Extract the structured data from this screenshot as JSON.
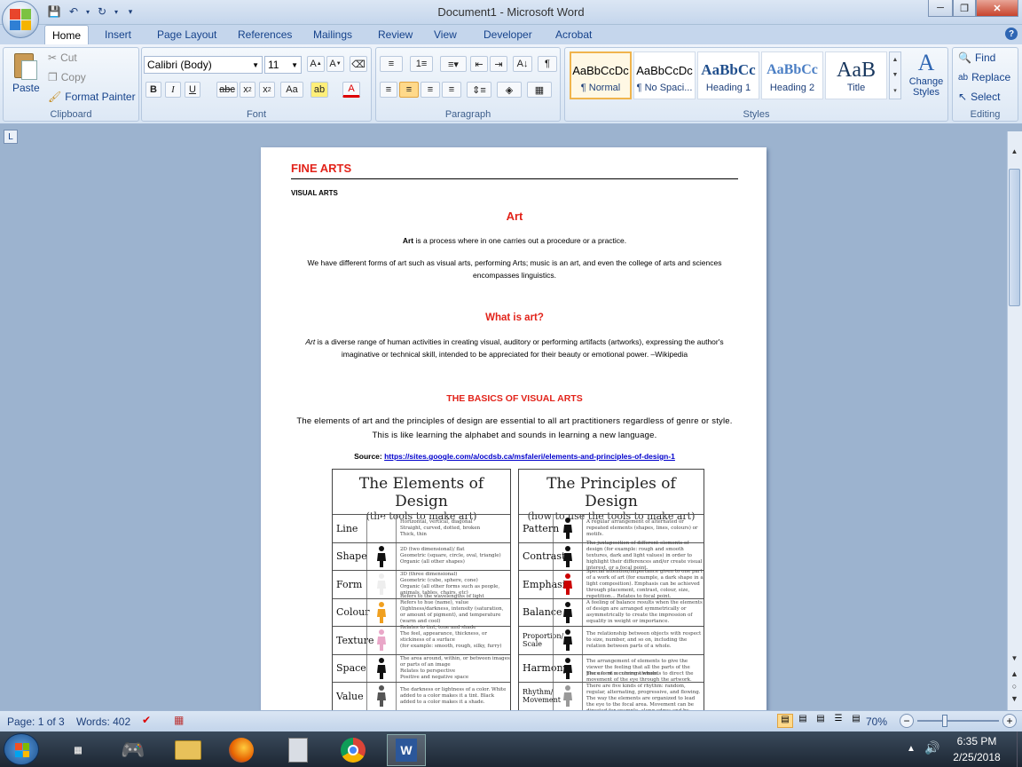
{
  "window": {
    "title": "Document1 - Microsoft Word"
  },
  "tabs": [
    "Home",
    "Insert",
    "Page Layout",
    "References",
    "Mailings",
    "Review",
    "View",
    "Developer",
    "Acrobat"
  ],
  "clipboard": {
    "paste": "Paste",
    "cut": "Cut",
    "copy": "Copy",
    "format_painter": "Format Painter",
    "label": "Clipboard"
  },
  "font": {
    "name": "Calibri (Body)",
    "size": "11",
    "label": "Font"
  },
  "paragraph": {
    "label": "Paragraph"
  },
  "styles": {
    "items": [
      {
        "preview": "AaBbCcDc",
        "name": "¶ Normal"
      },
      {
        "preview": "AaBbCcDc",
        "name": "¶ No Spaci..."
      },
      {
        "preview": "AaBbCc",
        "name": "Heading 1"
      },
      {
        "preview": "AaBbCc",
        "name": "Heading 2"
      },
      {
        "preview": "AaB",
        "name": "Title"
      }
    ],
    "change_styles": "Change Styles",
    "label": "Styles"
  },
  "editing": {
    "find": "Find",
    "replace": "Replace",
    "select": "Select",
    "label": "Editing"
  },
  "document": {
    "heading": "FINE ARTS",
    "subheading": "VISUAL ARTS",
    "art_title": "Art",
    "art_p1_bold": "Art",
    "art_p1_rest": " is a process where in one carries out a procedure or a practice.",
    "art_p2": "We have different forms of art such as visual arts, performing Arts; music is an art, and even the college of arts and sciences encompasses linguistics.",
    "what_title": "What is art?",
    "what_italic": "Art",
    "what_rest": " is a diverse range of human activities in creating visual, auditory or performing artifacts (artworks), expressing the author's imaginative or technical skill, intended to be appreciated for their beauty or emotional power. –Wikipedia",
    "basics_title": "THE BASICS OF VISUAL ARTS",
    "basics_p": "The elements of art and the principles of design are essential to all art practitioners regardless of genre or style. This is like learning the alphabet and sounds in learning a new language.",
    "source_label": "Source:",
    "source_url": "https://sites.google.com/a/ocdsb.ca/msfaleri/elements-and-principles-of-design-1"
  },
  "elements": {
    "title": "The Elements of Design",
    "subtitle": "(the tools to make art)",
    "rows": [
      {
        "label": "Line",
        "desc": "Horizontal, vertical, diagonal\nStraight, curved, dotted, broken\nThick, thin"
      },
      {
        "label": "Shape",
        "desc": "2D (two dimensional)/ flat\nGeometric (square, circle, oval, triangle)\nOrganic (all other shapes)"
      },
      {
        "label": "Form",
        "desc": "3D (three dimensional)\nGeometric (cube, sphere, cone)\nOrganic (all other forms such as people, animals, tables, chairs, etc)"
      },
      {
        "label": "Colour",
        "desc": "Refers to the wavelengths of light\nRefers to hue (name), value (lightness/darkness, intensity (saturation, or amount of pigment), and temperature (warm and cool)\nRelates to tint, tone and shade"
      },
      {
        "label": "Texture",
        "desc": "The feel, appearance, thickness, or stickiness of a surface\n(for example: smooth, rough, silky, furry)"
      },
      {
        "label": "Space",
        "desc": "The area around, within, or between images or parts of an image\nRelates to perspective\nPositive and negative space"
      },
      {
        "label": "Value",
        "desc": "The darkness or lightness of a color. White added to a color makes it a tint. Black added to a color makes it a shade."
      }
    ]
  },
  "principles": {
    "title": "The Principles of Design",
    "subtitle": "(how to use the tools to make art)",
    "rows": [
      {
        "label": "Pattern",
        "desc": "A regular arrangement of alternated or repeated elements (shapes, lines, colours) or motifs."
      },
      {
        "label": "Contrast",
        "desc": "The juxtaposition of different elements of design (for example: rough and smooth textures, dark and light values) in order to highlight their differences and/or create visual interest, or a focal point."
      },
      {
        "label": "Emphasis",
        "desc": "Special attention/importance given to one part of a work of art (for example, a dark shape in a light composition). Emphasis can be achieved through placement, contrast, colour, size, repetition... Relates to focal point."
      },
      {
        "label": "Balance",
        "desc": "A feeling of balance results when the elements of design are arranged symmetrically or asymmetrically to create the impression of equality in weight or importance."
      },
      {
        "label": "Proportion/ Scale",
        "desc": "The relationship between objects with respect to size, number, and so on, including the relation between parts of a whole."
      },
      {
        "label": "Harmony",
        "desc": "The arrangement of elements to give the viewer the feeling that all the parts of the piece form a coherent whole."
      },
      {
        "label": "Rhythm/ Movement",
        "desc": "The use of recurring elements to direct the movement of the eye through the artwork. There are five kinds of rhythm: random, regular, alternating, progressive, and flowing. The way the elements are organized to lead the eye to the focal area. Movement can be directed for example, along edges and by means of shape and colour."
      }
    ]
  },
  "status": {
    "page": "Page: 1 of 3",
    "words": "Words: 402",
    "zoom": "70%"
  },
  "clock": {
    "time": "6:35 PM",
    "date": "2/25/2018"
  }
}
